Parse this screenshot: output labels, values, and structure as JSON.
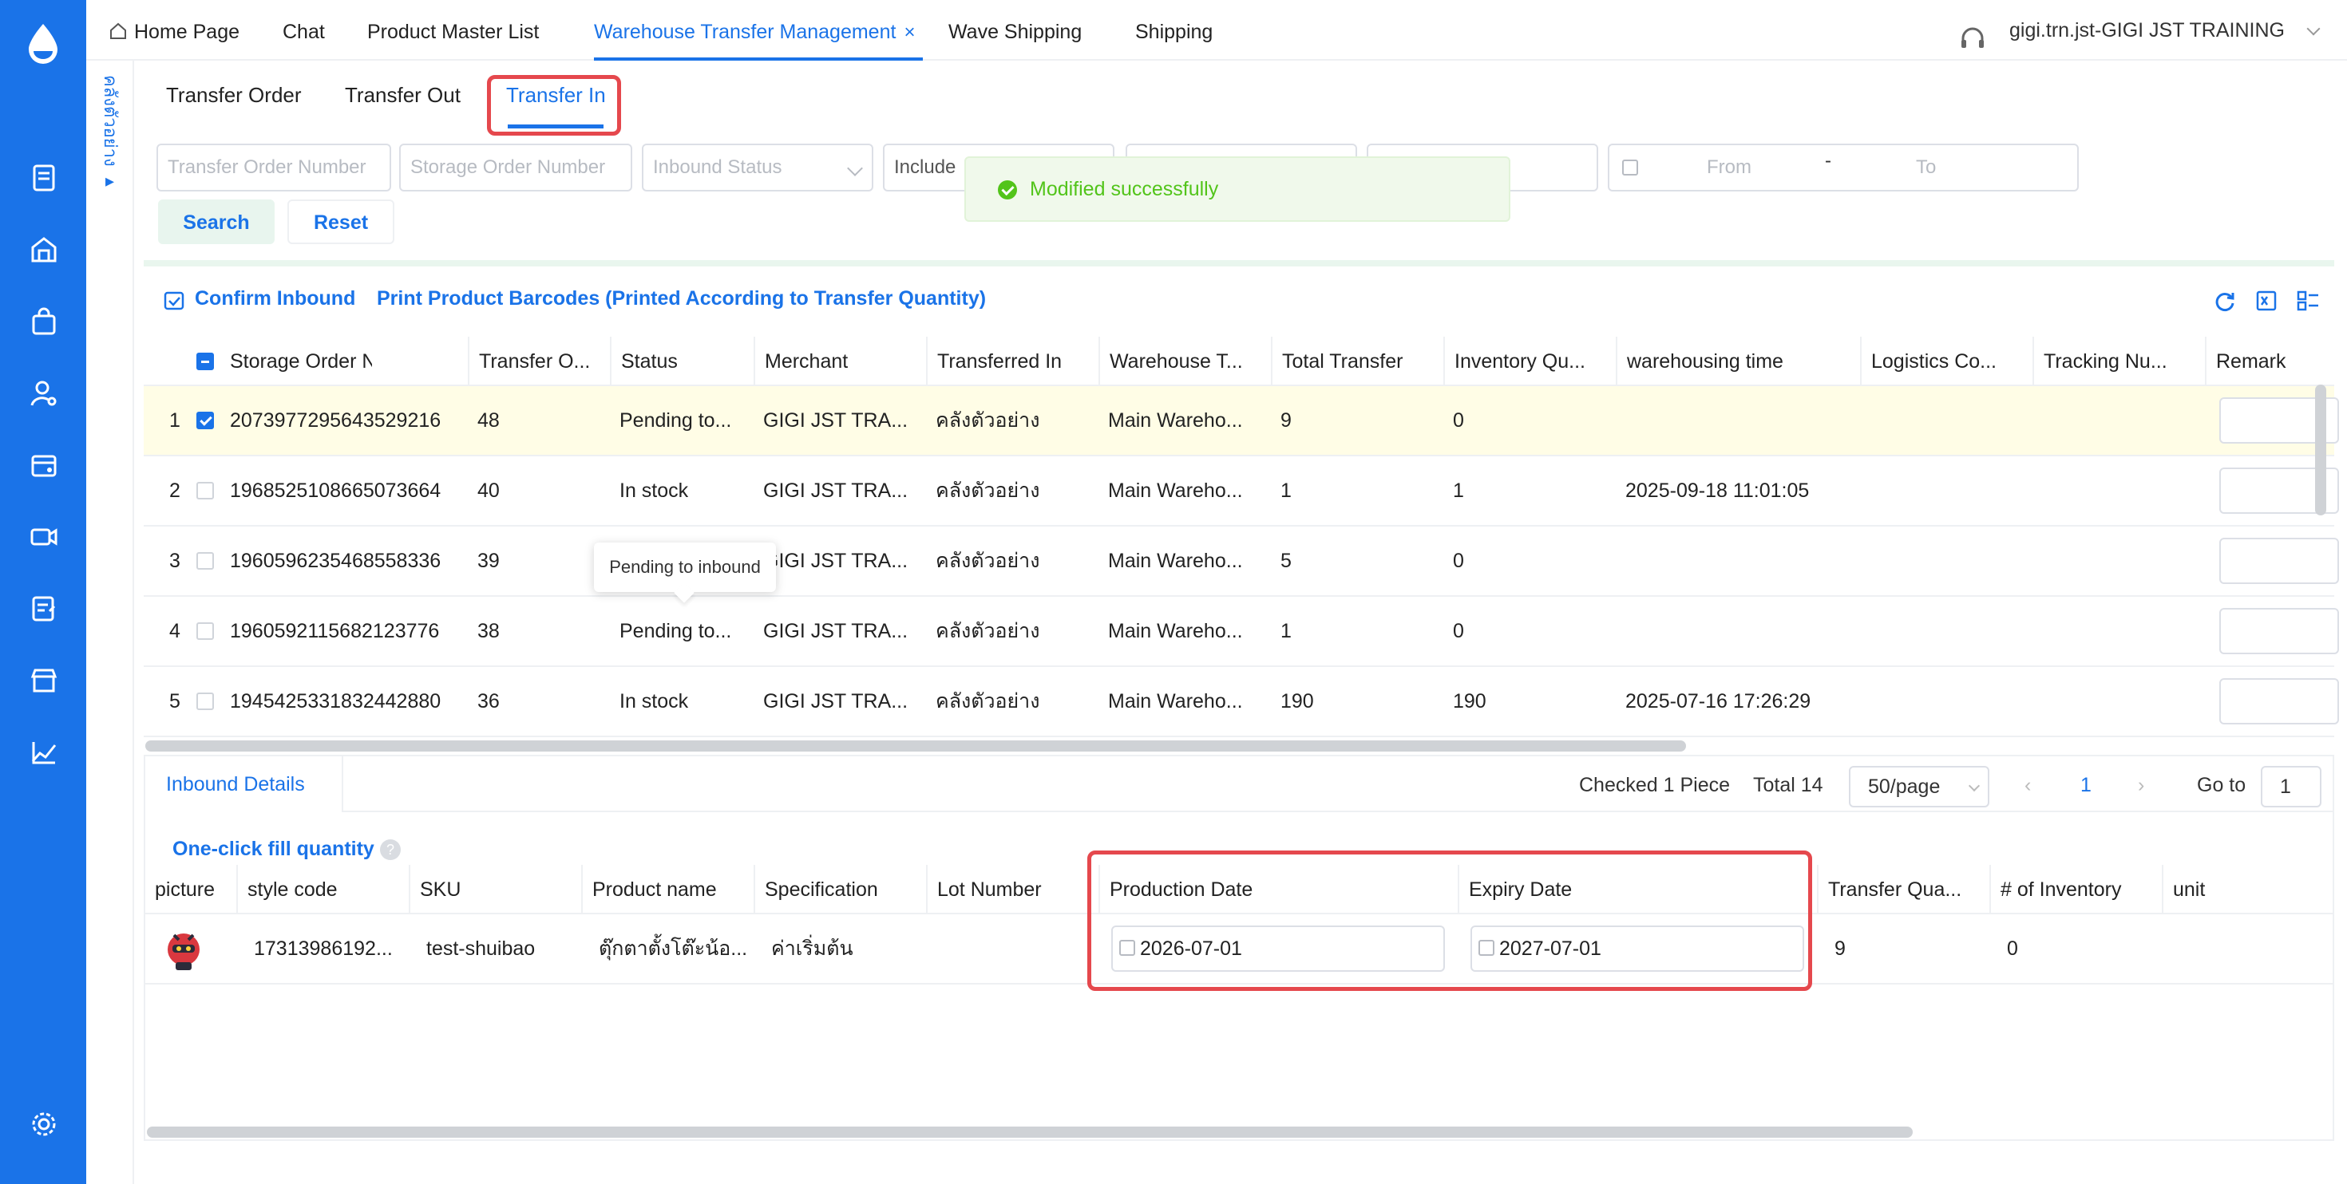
{
  "nav": {
    "tabs": [
      "Home Page",
      "Chat",
      "Product Master List",
      "Warehouse Transfer Management",
      "Wave Shipping",
      "Shipping"
    ],
    "active_close": "×",
    "user": "gigi.trn.jst-GIGI JST TRAINING"
  },
  "side_strip": {
    "label": "คลังตัวอย่าง ▸"
  },
  "subtabs": [
    "Transfer Order",
    "Transfer Out",
    "Transfer In"
  ],
  "filters": {
    "transfer_order_number": "Transfer Order Number",
    "storage_order_number": "Storage Order Number",
    "inbound_status": "Inbound Status",
    "include": "Include",
    "from": "From",
    "dash": "-",
    "to": "To",
    "search": "Search",
    "reset": "Reset"
  },
  "toast": "Modified successfully",
  "toolbar": {
    "confirm": "Confirm Inbound",
    "print": "Print Product Barcodes (Printed According to Transfer Quantity)"
  },
  "table": {
    "headers": [
      "Storage Order Number",
      "Transfer O...",
      "Status",
      "Merchant",
      "Transferred In",
      "Warehouse T...",
      "Total Transfer",
      "Inventory Qu...",
      "warehousing time",
      "Logistics Co...",
      "Tracking Nu...",
      "Remark"
    ],
    "rows": [
      {
        "idx": "1",
        "storage": "2073977295643529216",
        "transfer": "48",
        "status": "Pending to...",
        "merchant": "GIGI JST TRA...",
        "tin": "คลังตัวอย่าง",
        "wh": "Main Wareho...",
        "total": "9",
        "inv": "0",
        "time": "",
        "checked": true
      },
      {
        "idx": "2",
        "storage": "1968525108665073664",
        "transfer": "40",
        "status": "In stock",
        "merchant": "GIGI JST TRA...",
        "tin": "คลังตัวอย่าง",
        "wh": "Main Wareho...",
        "total": "1",
        "inv": "1",
        "time": "2025-09-18 11:01:05",
        "checked": false
      },
      {
        "idx": "3",
        "storage": "1960596235468558336",
        "transfer": "39",
        "status": "",
        "merchant": "GIGI JST TRA...",
        "tin": "คลังตัวอย่าง",
        "wh": "Main Wareho...",
        "total": "5",
        "inv": "0",
        "time": "",
        "checked": false
      },
      {
        "idx": "4",
        "storage": "1960592115682123776",
        "transfer": "38",
        "status": "Pending to...",
        "merchant": "GIGI JST TRA...",
        "tin": "คลังตัวอย่าง",
        "wh": "Main Wareho...",
        "total": "1",
        "inv": "0",
        "time": "",
        "checked": false
      },
      {
        "idx": "5",
        "storage": "1945425331832442880",
        "transfer": "36",
        "status": "In stock",
        "merchant": "GIGI JST TRA...",
        "tin": "คลังตัวอย่าง",
        "wh": "Main Wareho...",
        "total": "190",
        "inv": "190",
        "time": "2025-07-16 17:26:29",
        "checked": false
      }
    ],
    "tooltip": "Pending to inbound"
  },
  "details": {
    "tab": "Inbound Details",
    "checked": "Checked 1 Piece",
    "total": "Total 14",
    "page_size": "50/page",
    "page": "1",
    "goto_label": "Go to",
    "goto_value": "1",
    "oneclick": "One-click fill quantity",
    "help": "?",
    "headers": [
      "picture",
      "style code",
      "SKU",
      "Product name",
      "Specification",
      "Lot Number",
      "Production Date",
      "Expiry Date",
      "Transfer Qua...",
      "# of Inventory",
      "unit"
    ],
    "row": {
      "style_code": "17313986192...",
      "sku": "test-shuibao",
      "product_name": "ตุ๊กตาตั้งโต๊ะน้อ...",
      "specification": "ค่าเริ่มต้น",
      "lot": "",
      "production_date": "2026-07-01",
      "expiry_date": "2027-07-01",
      "transfer_qty": "9",
      "inventory": "0",
      "unit": ""
    }
  },
  "colors": {
    "brand": "#1a73e8",
    "highlight": "#e5484d",
    "success": "#52c41a",
    "selected_row": "#fffde6"
  },
  "icons": [
    "logo-drop-icon",
    "document-icon",
    "warehouse-icon",
    "shopping-bag-icon",
    "user-settings-icon",
    "storage-settings-icon",
    "video-icon",
    "report-icon",
    "store-icon",
    "chart-icon",
    "settings-gear-icon",
    "headset-icon",
    "home-icon",
    "refresh-icon",
    "excel-icon",
    "columns-icon",
    "calendar-icon"
  ]
}
